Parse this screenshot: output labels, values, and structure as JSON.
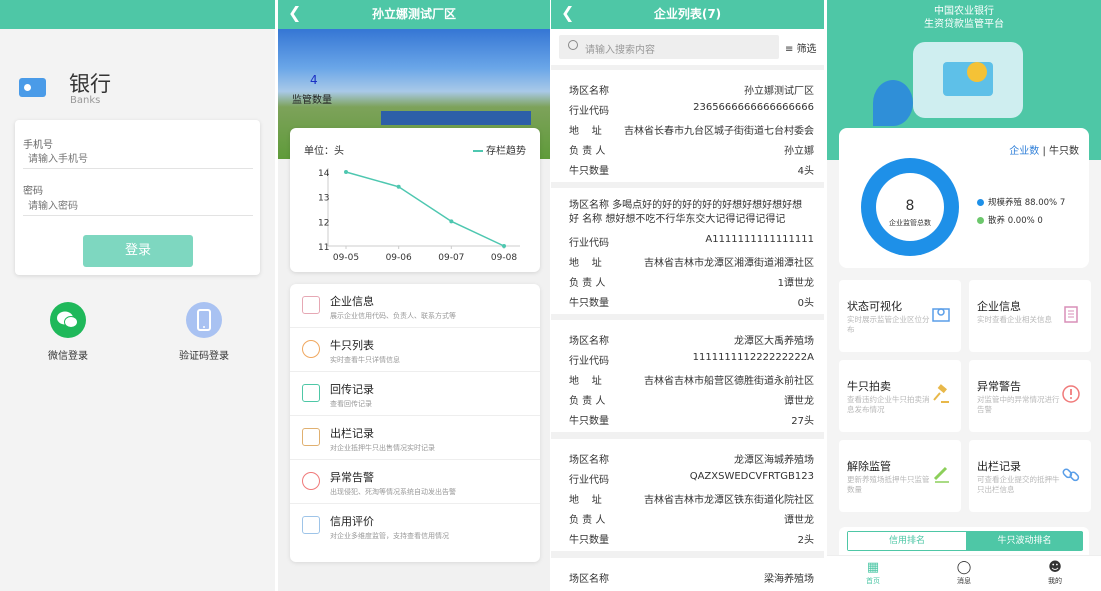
{
  "login": {
    "bank_title": "银行",
    "bank_sub": "Banks",
    "phone_label": "手机号",
    "phone_placeholder": "请输入手机号",
    "pwd_label": "密码",
    "pwd_placeholder": "请输入密码",
    "login_button": "登录",
    "wechat_label": "微信登录",
    "sms_label": "验证码登录"
  },
  "factory": {
    "title": "孙立娜测试厂区",
    "count": "4",
    "count_label": "监管数量",
    "menu": [
      {
        "title": "企业信息",
        "desc": "展示企业信用代码、负责人、联系方式等"
      },
      {
        "title": "牛只列表",
        "desc": "实时查看牛只详情信息"
      },
      {
        "title": "回传记录",
        "desc": "查看回传记录"
      },
      {
        "title": "出栏记录",
        "desc": "对企业抵押牛只出售情况实时记录"
      },
      {
        "title": "异常告警",
        "desc": "出现侵犯、死淘等情况系统自动发出告警"
      },
      {
        "title": "信用评价",
        "desc": "对企业多维度监管，支持查看信用情况"
      }
    ]
  },
  "chart_data": {
    "type": "line",
    "title": "",
    "unit_label": "单位：头",
    "series": [
      {
        "name": "存栏趋势",
        "values": [
          14,
          13.4,
          12,
          11
        ]
      }
    ],
    "categories": [
      "09-05",
      "09-06",
      "09-07",
      "09-08"
    ],
    "ylim": [
      11,
      14
    ],
    "yticks": [
      "14",
      "13",
      "12",
      "11"
    ],
    "color": "#4ec7b0"
  },
  "enterprise_list": {
    "title": "企业列表(7)",
    "search_placeholder": "请输入搜索内容",
    "filter_label": "筛选",
    "labels": {
      "name": "场区名称",
      "code": "行业代码",
      "addr": "地    址",
      "owner": "负 责 人",
      "cattle": "牛只数量"
    },
    "items": [
      {
        "name": "孙立娜测试厂区",
        "code": "2365666666666666666",
        "addr": "吉林省长春市九台区城子街街道七台村委会",
        "owner": "孙立娜",
        "cattle": "4头"
      },
      {
        "name_full": "场区名称 多喝点好的好的好的好的好想好想好想好想好 名称 想好想不吃不行华东交大记得记得记得记",
        "code": "A1111111111111111",
        "addr": "吉林省吉林市龙潭区湘潭街道湘潭社区",
        "owner": "1谭世龙",
        "cattle": "0头"
      },
      {
        "name": "龙潭区大禹养殖场",
        "code": "111111111222222222A",
        "addr": "吉林省吉林市船营区德胜街道永前社区",
        "owner": "谭世龙",
        "cattle": "27头"
      },
      {
        "name": "龙潭区海城养殖场",
        "code": "QAZXSWEDCVFRTGB123",
        "addr": "吉林省吉林市龙潭区铁东街道化院社区",
        "owner": "谭世龙",
        "cattle": "2头"
      },
      {
        "name": "梁海养殖场"
      }
    ]
  },
  "dashboard": {
    "title_line1": "中国农业银行",
    "title_line2": "生资贷款监管平台",
    "toggle_a": "企业数",
    "toggle_sep": "|",
    "toggle_b": "牛只数",
    "donut_value": "8",
    "donut_label": "企业监管总数",
    "legend": [
      {
        "text": "规模养殖 88.00% 7",
        "color": "#1e90e8"
      },
      {
        "text": "散养 0.00% 0",
        "color": "#6cc76c"
      }
    ],
    "tiles": [
      {
        "title": "状态可视化",
        "desc": "实时展示监管企业区位分布"
      },
      {
        "title": "企业信息",
        "desc": "实时查看企业相关信息"
      },
      {
        "title": "牛只拍卖",
        "desc": "查看违约企业牛只拍卖消息发布情况"
      },
      {
        "title": "异常警告",
        "desc": "对监管中的异常情况进行告警"
      },
      {
        "title": "解除监管",
        "desc": "更新养殖场抵押牛只监管数量"
      },
      {
        "title": "出栏记录",
        "desc": "可查看企业提交的抵押牛只出栏信息"
      }
    ],
    "rank_a": "信用排名",
    "rank_b": "牛只波动排名",
    "tabs": [
      "首页",
      "消息",
      "我的"
    ]
  }
}
